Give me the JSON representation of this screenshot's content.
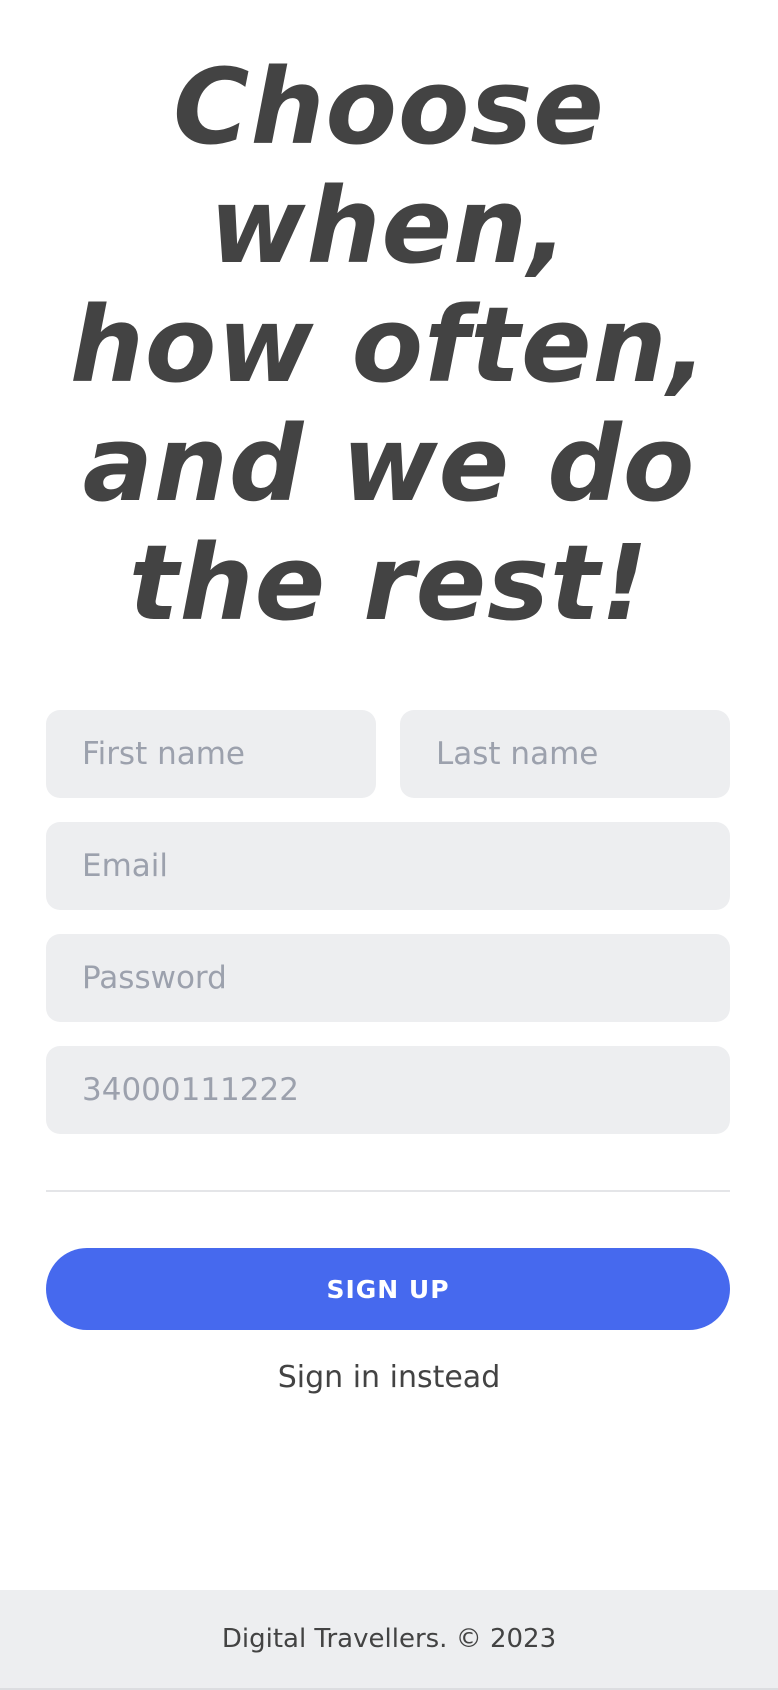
{
  "hero": {
    "lines": [
      "Choose",
      "when,",
      "how often,",
      "and we do",
      "the rest!"
    ]
  },
  "form": {
    "first_name": {
      "placeholder": "First name",
      "value": ""
    },
    "last_name": {
      "placeholder": "Last name",
      "value": ""
    },
    "email": {
      "placeholder": "Email",
      "value": ""
    },
    "password": {
      "placeholder": "Password",
      "value": ""
    },
    "phone": {
      "placeholder": "34000111222",
      "value": ""
    },
    "submit_label": "SIGN UP",
    "signin_label": "Sign in instead"
  },
  "footer": {
    "text": "Digital Travellers. © 2023"
  },
  "colors": {
    "primary": "#4669ee",
    "text": "#434343",
    "input_background": "#edeef0",
    "placeholder": "#9ca1ad",
    "footer_background": "#edeef0"
  }
}
